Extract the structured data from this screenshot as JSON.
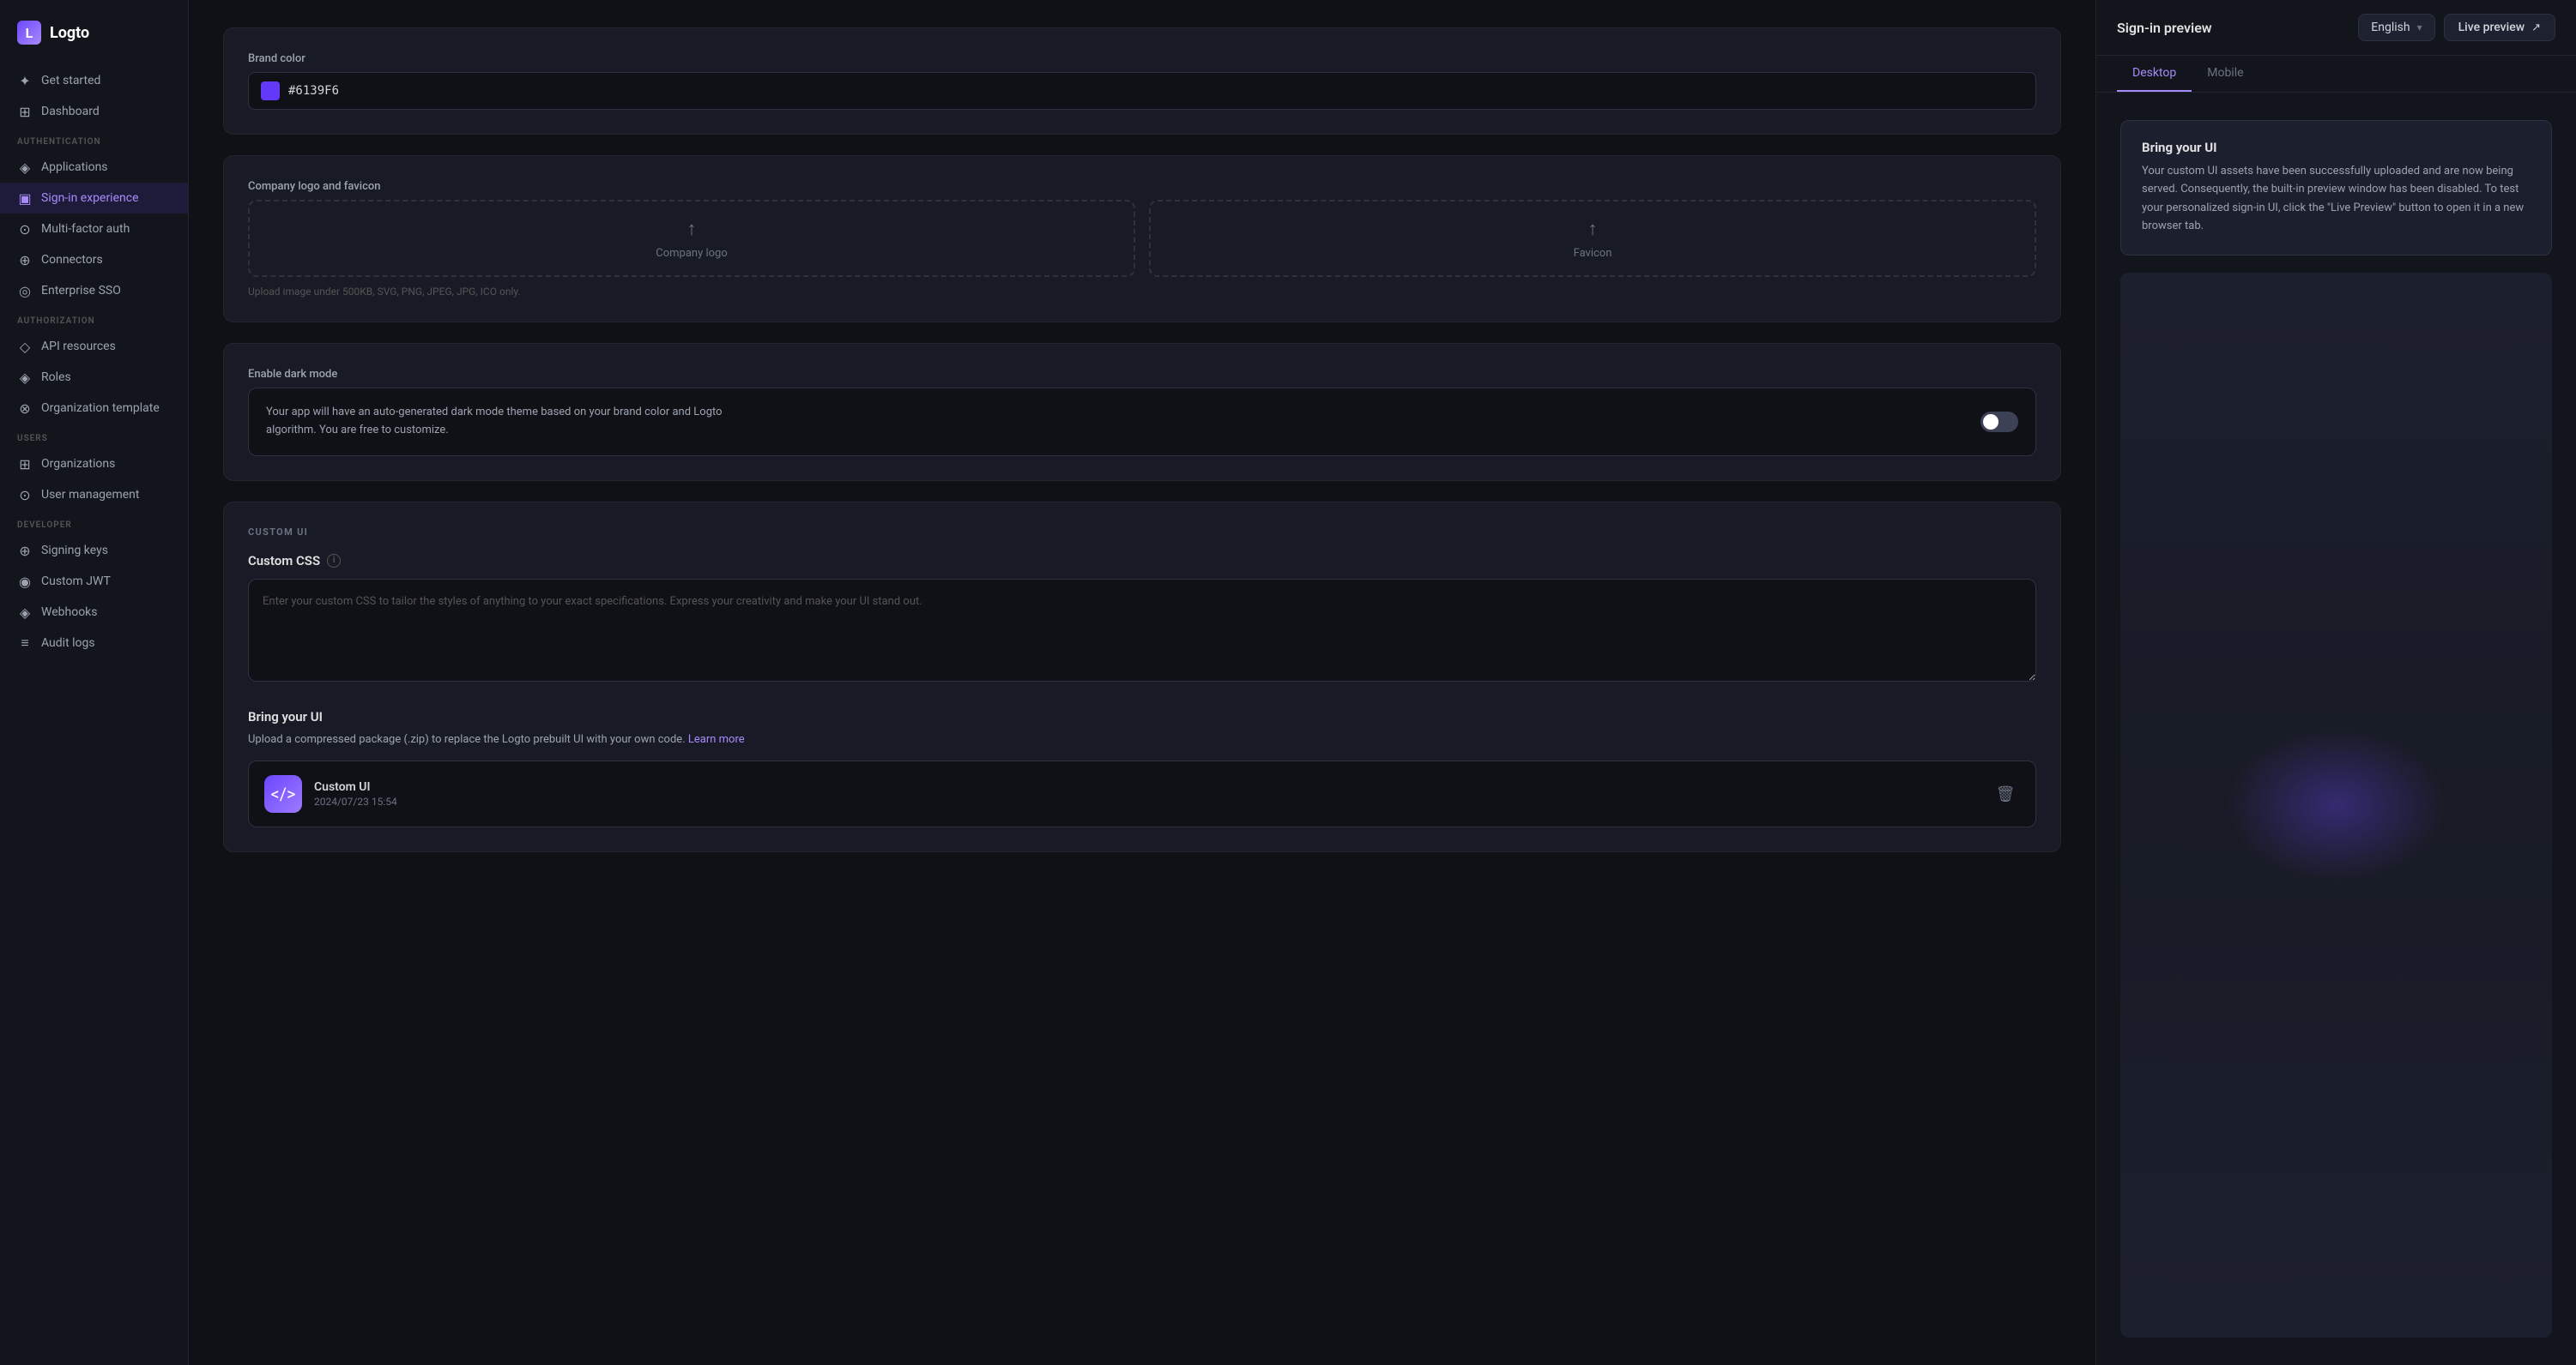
{
  "sidebar": {
    "logo_text": "Logto",
    "sections": [
      {
        "label": "",
        "items": [
          {
            "id": "get-started",
            "label": "Get started",
            "icon": "✦",
            "active": false
          },
          {
            "id": "dashboard",
            "label": "Dashboard",
            "icon": "⊞",
            "active": false
          }
        ]
      },
      {
        "label": "Authentication",
        "items": [
          {
            "id": "applications",
            "label": "Applications",
            "icon": "◈",
            "active": false
          },
          {
            "id": "sign-in-experience",
            "label": "Sign-in experience",
            "icon": "▣",
            "active": true
          },
          {
            "id": "multi-factor-auth",
            "label": "Multi-factor auth",
            "icon": "⊙",
            "active": false
          },
          {
            "id": "connectors",
            "label": "Connectors",
            "icon": "⊕",
            "active": false
          },
          {
            "id": "enterprise-sso",
            "label": "Enterprise SSO",
            "icon": "◎",
            "active": false
          }
        ]
      },
      {
        "label": "Authorization",
        "items": [
          {
            "id": "api-resources",
            "label": "API resources",
            "icon": "◇",
            "active": false
          },
          {
            "id": "roles",
            "label": "Roles",
            "icon": "◈",
            "active": false
          },
          {
            "id": "organization-template",
            "label": "Organization template",
            "icon": "⊗",
            "active": false
          }
        ]
      },
      {
        "label": "Users",
        "items": [
          {
            "id": "organizations",
            "label": "Organizations",
            "icon": "⊞",
            "active": false
          },
          {
            "id": "user-management",
            "label": "User management",
            "icon": "⊙",
            "active": false
          }
        ]
      },
      {
        "label": "Developer",
        "items": [
          {
            "id": "signing-keys",
            "label": "Signing keys",
            "icon": "⊕",
            "active": false
          },
          {
            "id": "custom-jwt",
            "label": "Custom JWT",
            "icon": "◉",
            "active": false
          },
          {
            "id": "webhooks",
            "label": "Webhooks",
            "icon": "◈",
            "active": false
          },
          {
            "id": "audit-logs",
            "label": "Audit logs",
            "icon": "≡",
            "active": false
          }
        ]
      }
    ]
  },
  "content": {
    "brand_color": {
      "label": "Brand color",
      "value": "#6139F6",
      "display": "#6139F6",
      "swatch_color": "#6139f6"
    },
    "company_logo": {
      "label": "Company logo and favicon",
      "logo_box_label": "Company logo",
      "favicon_box_label": "Favicon",
      "upload_hint": "Upload image under 500KB, SVG, PNG, JPEG, JPG, ICO only."
    },
    "dark_mode": {
      "label": "Enable dark mode",
      "description": "Your app will have an auto-generated dark mode theme based on your brand color and Logto algorithm. You are free to customize."
    },
    "custom_ui": {
      "section_label": "CUSTOM UI",
      "custom_css": {
        "title": "Custom CSS",
        "placeholder": "Enter your custom CSS to tailor the styles of anything to your exact specifications. Express your creativity and make your UI stand out."
      },
      "bring_ui": {
        "title": "Bring your UI",
        "description": "Upload a compressed package (.zip) to replace the Logto prebuilt UI with your own code.",
        "learn_more": "Learn more",
        "card": {
          "name": "Custom UI",
          "date": "2024/07/23 15:54",
          "icon": "</>"
        }
      }
    }
  },
  "preview": {
    "title": "Sign-in preview",
    "language": "English",
    "live_preview_btn": "Live preview",
    "tabs": [
      {
        "id": "desktop",
        "label": "Desktop",
        "active": true
      },
      {
        "id": "mobile",
        "label": "Mobile",
        "active": false
      }
    ],
    "message_box": {
      "title": "Bring your UI",
      "text": "Your custom UI assets have been successfully uploaded and are now being served. Consequently, the built-in preview window has been disabled. To test your personalized sign-in UI, click the \"Live Preview\" button to open it in a new browser tab."
    }
  }
}
